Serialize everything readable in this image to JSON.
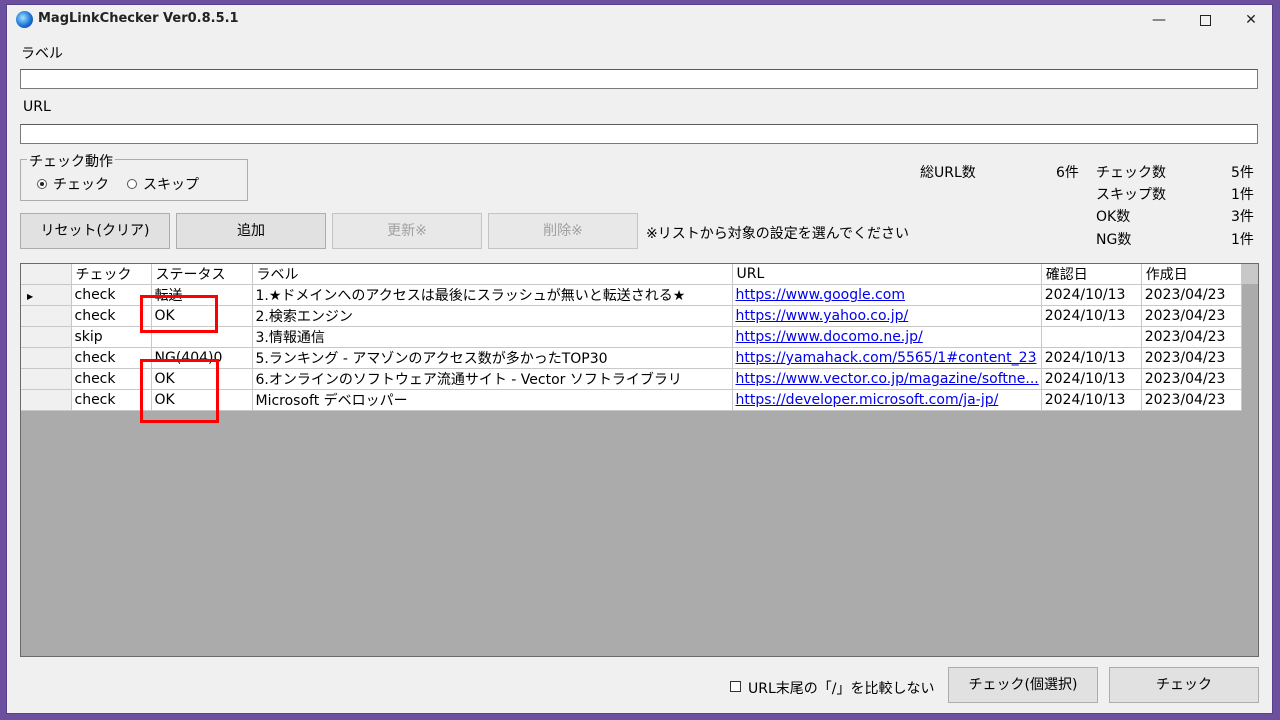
{
  "window": {
    "title": "MagLinkChecker Ver0.8.5.1",
    "controls": {
      "minimize": "—",
      "close": "✕"
    }
  },
  "form": {
    "label_caption": "ラベル",
    "label_value": "",
    "url_caption": "URL",
    "url_value": ""
  },
  "check_action": {
    "group_title": "チェック動作",
    "options": [
      {
        "label": "チェック",
        "selected": true
      },
      {
        "label": "スキップ",
        "selected": false
      }
    ]
  },
  "buttons": {
    "reset": "リセット(クリア)",
    "add": "追加",
    "update": "更新※",
    "delete": "削除※",
    "note": "※リストから対象の設定を選んでください"
  },
  "stats": {
    "total_label": "総URL数",
    "total_value": "6件",
    "check_label": "チェック数",
    "check_value": "5件",
    "skip_label": "スキップ数",
    "skip_value": "1件",
    "ok_label": "OK数",
    "ok_value": "3件",
    "ng_label": "NG数",
    "ng_value": "1件"
  },
  "table": {
    "columns": [
      "チェック",
      "ステータス",
      "ラベル",
      "URL",
      "確認日",
      "作成日"
    ],
    "rows": [
      {
        "check": "check",
        "status": "転送",
        "label": "1.★ドメインへのアクセスは最後にスラッシュが無いと転送される★",
        "url": "https://www.google.com",
        "confirmed": "2024/10/13",
        "created": "2023/04/23",
        "current": true
      },
      {
        "check": "check",
        "status": "OK",
        "label": "2.検索エンジン",
        "url": "https://www.yahoo.co.jp/",
        "confirmed": "2024/10/13",
        "created": "2023/04/23"
      },
      {
        "check": "skip",
        "status": "",
        "label": "3.情報通信",
        "url": "https://www.docomo.ne.jp/",
        "confirmed": "",
        "created": "2023/04/23"
      },
      {
        "check": "check",
        "status": "NG(404)0",
        "label": "5.ランキング - アマゾンのアクセス数が多かったTOP30",
        "url": "https://yamahack.com/5565/1#content_23",
        "confirmed": "2024/10/13",
        "created": "2023/04/23"
      },
      {
        "check": "check",
        "status": "OK",
        "label": "6.オンラインのソフトウェア流通サイト - Vector ソフトライブラリ",
        "url": "https://www.vector.co.jp/magazine/softne...",
        "confirmed": "2024/10/13",
        "created": "2023/04/23"
      },
      {
        "check": "check",
        "status": "OK",
        "label": "Microsoft デベロッパー",
        "url": "https://developer.microsoft.com/ja-jp/",
        "confirmed": "2024/10/13",
        "created": "2023/04/23"
      }
    ]
  },
  "footer": {
    "trailing_slash_option": "URL末尾の「/」を比較しない",
    "trailing_slash_checked": false,
    "check_selected_button": "チェック(個選択)",
    "check_button": "チェック"
  },
  "colors": {
    "desktop": "#6d4fa0",
    "window_bg": "#f0f0f0",
    "grid_empty": "#ababab",
    "link": "#0000ee",
    "highlight": "#ff0000"
  },
  "icons": {
    "app": "globe-icon",
    "row_pointer": "triangle-right-icon"
  }
}
